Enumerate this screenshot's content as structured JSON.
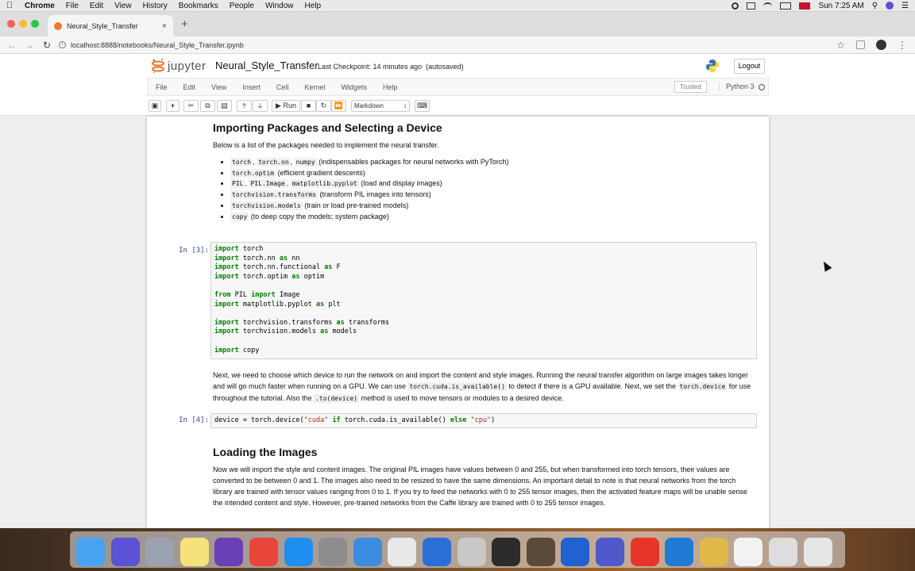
{
  "os_menubar": {
    "app_name": "Chrome",
    "items": [
      "File",
      "Edit",
      "View",
      "History",
      "Bookmarks",
      "People",
      "Window",
      "Help"
    ],
    "clock": "Sun 7:25 AM"
  },
  "browser": {
    "tab_title": "Neural_Style_Transfer",
    "tab_close": "×",
    "new_tab": "+",
    "url": "localhost:8888/notebooks/Neural_Style_Transfer.ipynb"
  },
  "jupyter": {
    "logo_text": "jupyter",
    "notebook_name": "Neural_Style_Transfer",
    "checkpoint": "Last Checkpoint: 14 minutes ago",
    "autosave": "(autosaved)",
    "logout": "Logout",
    "menus": [
      "File",
      "Edit",
      "View",
      "Insert",
      "Cell",
      "Kernel",
      "Widgets",
      "Help"
    ],
    "trusted": "Trusted",
    "kernel_name": "Python 3",
    "run_label": "Run",
    "cell_type": "Markdown"
  },
  "notebook": {
    "section1": {
      "heading": "Importing Packages and Selecting a Device",
      "intro": "Below is a list of the packages needed to implement the neural transfer.",
      "packages": [
        {
          "codes": [
            "torch",
            "torch.nn",
            "numpy"
          ],
          "desc": "(indispensables packages for neural networks with PyTorch)"
        },
        {
          "codes": [
            "torch.optim"
          ],
          "desc": "(efficient gradient descents)"
        },
        {
          "codes": [
            "PIL",
            "PIL.Image",
            "matplotlib.pyplot"
          ],
          "desc": "(load and display images)"
        },
        {
          "codes": [
            "torchvision.transforms"
          ],
          "desc": "(transform PIL images into tensors)"
        },
        {
          "codes": [
            "torchvision.models"
          ],
          "desc": "(train or load pre-trained models)"
        },
        {
          "codes": [
            "copy"
          ],
          "desc": "(to deep copy the models; system package)"
        }
      ]
    },
    "cell3": {
      "prompt": "In [3]:",
      "lines": [
        [
          {
            "k": "import"
          },
          {
            "t": " torch"
          }
        ],
        [
          {
            "k": "import"
          },
          {
            "t": " torch.nn "
          },
          {
            "k": "as"
          },
          {
            "t": " nn"
          }
        ],
        [
          {
            "k": "import"
          },
          {
            "t": " torch.nn.functional "
          },
          {
            "k": "as"
          },
          {
            "t": " F"
          }
        ],
        [
          {
            "k": "import"
          },
          {
            "t": " torch.optim "
          },
          {
            "k": "as"
          },
          {
            "t": " optim"
          }
        ],
        [],
        [
          {
            "k": "from"
          },
          {
            "t": " PIL "
          },
          {
            "k": "import"
          },
          {
            "t": " Image"
          }
        ],
        [
          {
            "k": "import"
          },
          {
            "t": " matplotlib.pyplot "
          },
          {
            "k": "as"
          },
          {
            "t": " plt"
          }
        ],
        [],
        [
          {
            "k": "import"
          },
          {
            "t": " torchvision.transforms "
          },
          {
            "k": "as"
          },
          {
            "t": " transforms"
          }
        ],
        [
          {
            "k": "import"
          },
          {
            "t": " torchvision.models "
          },
          {
            "k": "as"
          },
          {
            "t": " models"
          }
        ],
        [],
        [
          {
            "k": "import"
          },
          {
            "t": " copy"
          }
        ]
      ]
    },
    "para2": {
      "t1": "Next, we need to choose which device to run the network on and import the content and style images. Running the neural transfer algorithm on large images takes longer and will go much faster when running on a GPU. We can use ",
      "c1": "torch.cuda.is_available()",
      "t2": " to detect if there is a GPU available. Next, we set the ",
      "c2": "torch.device",
      "t3": " for use throughout the tutorial. Also the ",
      "c3": ".to(device)",
      "t4": " method is used to move tensors or modules to a desired device."
    },
    "cell4": {
      "prompt": "In [4]:",
      "line": [
        {
          "t": "device = torch.device("
        },
        {
          "s": "\"cuda\""
        },
        {
          "t": " "
        },
        {
          "k": "if"
        },
        {
          "t": " torch.cuda.is_available() "
        },
        {
          "k": "else"
        },
        {
          "t": " "
        },
        {
          "s": "\"cpu\""
        },
        {
          "t": ")"
        }
      ]
    },
    "section2": {
      "heading": "Loading the Images",
      "para": "Now we will import the style and content images. The original PIL images have values between 0 and 255, but when transformed into torch tensors, their values are converted to be between 0 and 1. The images also need to be resized to have the same dimensions. An important detail to note is that neural networks from the torch library are trained with tensor values ranging from 0 to 1. If you try to feed the networks with 0 to 255 tensor images, then the activated feature maps will be unable sense the intended content and style. However, pre-trained networks from the Caffe library are trained with 0 to 255 tensor images."
    }
  },
  "dock": {
    "apps": [
      "finder-icon",
      "siri-icon",
      "launchpad-icon",
      "notes-icon",
      "visual-studio-icon",
      "chrome-icon",
      "app-store-icon",
      "system-preferences-icon",
      "xcode-icon",
      "preview-icon",
      "quicktime-icon",
      "help-icon",
      "terminal-icon",
      "anaconda-icon",
      "teamviewer-icon",
      "teams-icon",
      "charts-icon",
      "vscode-icon",
      "database-icon",
      "file-icon",
      "window-icon",
      "trash-icon"
    ],
    "colors": [
      "#4aa3f0",
      "#5b52d6",
      "#9aa2b0",
      "#f6e27a",
      "#6b3fb5",
      "#e9463b",
      "#1e8ff0",
      "#8d8d8d",
      "#3a8de0",
      "#e9e9e9",
      "#2a6fd6",
      "#c9c9c9",
      "#2b2b2b",
      "#5a4a3a",
      "#1f62d0",
      "#5059c9",
      "#e8352a",
      "#1f7ad6",
      "#e0b84a",
      "#f2f2f2",
      "#dddddd",
      "#e6e6e6"
    ]
  }
}
